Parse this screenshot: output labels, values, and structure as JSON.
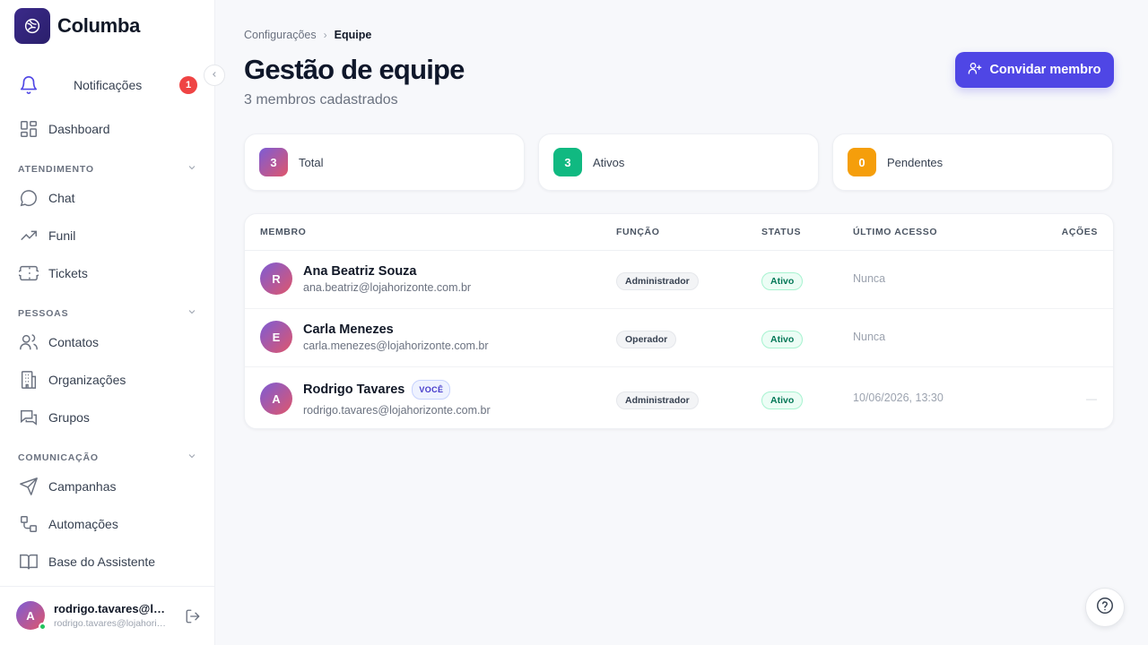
{
  "app": {
    "name": "Columba"
  },
  "sidebar": {
    "notifications": {
      "label": "Notificações",
      "count": "1"
    },
    "dashboard": {
      "label": "Dashboard"
    },
    "sections": [
      {
        "title": "ATENDIMENTO",
        "items": [
          {
            "label": "Chat",
            "icon": "chat-icon"
          },
          {
            "label": "Funil",
            "icon": "trending-icon"
          },
          {
            "label": "Tickets",
            "icon": "ticket-icon"
          }
        ]
      },
      {
        "title": "PESSOAS",
        "items": [
          {
            "label": "Contatos",
            "icon": "users-icon"
          },
          {
            "label": "Organizações",
            "icon": "building-icon"
          },
          {
            "label": "Grupos",
            "icon": "groups-icon"
          }
        ]
      },
      {
        "title": "COMUNICAÇÃO",
        "items": [
          {
            "label": "Campanhas",
            "icon": "send-icon"
          },
          {
            "label": "Automações",
            "icon": "workflow-icon"
          },
          {
            "label": "Base do Assistente",
            "icon": "book-icon"
          }
        ]
      }
    ],
    "user": {
      "initial": "A",
      "name": "rodrigo.tavares@lojahorizonte.com.br",
      "email": "rodrigo.tavares@lojahorizonte.com.br"
    }
  },
  "breadcrumb": {
    "parent": "Configurações",
    "separator": "›",
    "current": "Equipe"
  },
  "page": {
    "title": "Gestão de equipe",
    "subtitle": "3 membros cadastrados",
    "invite_label": "Convidar membro"
  },
  "stats": [
    {
      "value": "3",
      "label": "Total",
      "color": "#7c5cd6"
    },
    {
      "value": "3",
      "label": "Ativos",
      "color": "#10b981"
    },
    {
      "value": "0",
      "label": "Pendentes",
      "color": "#f59e0b"
    }
  ],
  "table": {
    "headers": {
      "member": "MEMBRO",
      "role": "FUNÇÃO",
      "status": "STATUS",
      "last_access": "ÚLTIMO ACESSO",
      "actions": "AÇÕES"
    },
    "rows": [
      {
        "initial": "R",
        "name": "Ana Beatriz Souza",
        "email": "ana.beatriz@lojahorizonte.com.br",
        "role": "Administrador",
        "status": "Ativo",
        "last_access": "Nunca",
        "you": "",
        "action": ""
      },
      {
        "initial": "E",
        "name": "Carla Menezes",
        "email": "carla.menezes@lojahorizonte.com.br",
        "role": "Operador",
        "status": "Ativo",
        "last_access": "Nunca",
        "you": "",
        "action": ""
      },
      {
        "initial": "A",
        "name": "Rodrigo Tavares",
        "email": "rodrigo.tavares@lojahorizonte.com.br",
        "role": "Administrador",
        "status": "Ativo",
        "last_access": "10/06/2026, 13:30",
        "you": "VOCÊ",
        "action": "—"
      }
    ]
  },
  "colors": {
    "accent": "#4f46e5",
    "danger": "#ef4444",
    "success": "#10b981",
    "warning": "#f59e0b"
  }
}
